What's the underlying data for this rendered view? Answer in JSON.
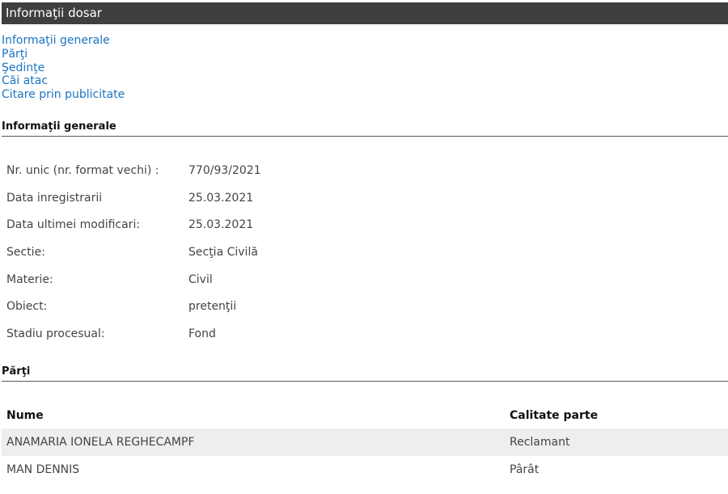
{
  "header": {
    "title": "Informaţii dosar"
  },
  "nav": {
    "items": [
      "Informaţii generale",
      "Părţi",
      "Şedinţe",
      "Căi atac",
      "Citare prin publicitate"
    ]
  },
  "sections": {
    "general_title": "Informaţii generale",
    "parti_title": "Părţi"
  },
  "general": {
    "rows": [
      {
        "label": "Nr. unic (nr. format vechi) :",
        "value": "770/93/2021"
      },
      {
        "label": "Data inregistrarii",
        "value": "25.03.2021"
      },
      {
        "label": "Data ultimei modificari:",
        "value": "25.03.2021"
      },
      {
        "label": "Sectie:",
        "value": "Secţia Civilă"
      },
      {
        "label": "Materie:",
        "value": "Civil"
      },
      {
        "label": "Obiect:",
        "value": "pretenţii"
      },
      {
        "label": "Stadiu procesual:",
        "value": "Fond"
      }
    ]
  },
  "parti": {
    "columns": [
      "Nume",
      "Calitate parte"
    ],
    "rows": [
      {
        "nume": "ANAMARIA IONELA REGHECAMPF",
        "calitate": "Reclamant"
      },
      {
        "nume": "MAN DENNIS",
        "calitate": "Pârât"
      }
    ]
  }
}
